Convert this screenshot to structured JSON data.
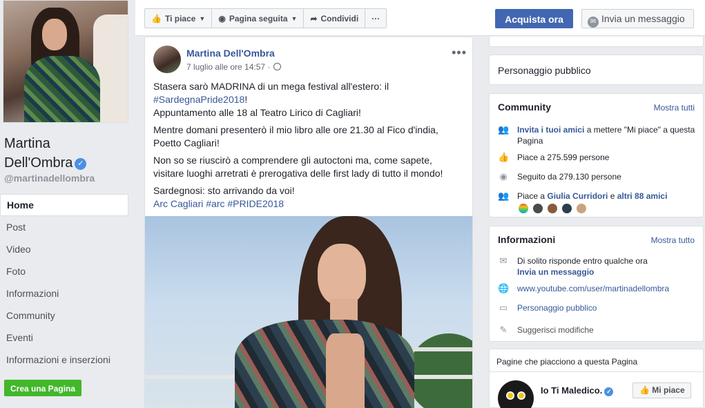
{
  "page": {
    "name_line1": "Martina",
    "name_line2": "Dell'Ombra",
    "handle": "@martinadellombra"
  },
  "nav": {
    "items": [
      "Home",
      "Post",
      "Video",
      "Foto",
      "Informazioni",
      "Community",
      "Eventi",
      "Informazioni e inserzioni"
    ],
    "active": "Home",
    "create_page": "Crea una Pagina"
  },
  "actions": {
    "like": "Ti piace",
    "follow": "Pagina seguita",
    "share": "Condividi",
    "more": "···",
    "buy": "Acquista ora",
    "message": "Invia un messaggio"
  },
  "post": {
    "author": "Martina Dell'Ombra",
    "time": "7 luglio alle ore 14:57 ·",
    "more": "•••",
    "p1_a": "Stasera sarò MADRINA di un mega festival all'estero: il",
    "p1_tag": "#SardegnaPride2018",
    "p1_b": "!",
    "p1_c": "Appuntamento alle 18 al Teatro Lirico di Cagliari!",
    "p2": "Mentre domani presenterò il mio libro alle ore 21.30 al Fico d'india, Poetto Cagliari!",
    "p3": "Non so se riuscirò a comprendere gli autoctoni ma, come sapete, visitare luoghi arretrati è prerogativa delle first lady di tutto il mondo!",
    "p4": "Sardegnosi: sto arrivando da voi!",
    "p4_tags": "Arc Cagliari #arc #PRIDE2018"
  },
  "sidebar": {
    "category": "Personaggio pubblico",
    "community": {
      "title": "Community",
      "see_all": "Mostra tutti",
      "invite_link": "Invita i tuoi amici",
      "invite_rest": " a mettere \"Mi piace\" a questa Pagina",
      "likes": "Piace a 275.599 persone",
      "followers": "Seguito da 279.130 persone",
      "friends_prefix": "Piace a ",
      "friend_name": "Giulia Curridori",
      "friends_mid": " e ",
      "friends_more": "altri 88 amici"
    },
    "info": {
      "title": "Informazioni",
      "see_all": "Mostra tutto",
      "response": "Di solito risponde entro qualche ora",
      "send_message": "Invia un messaggio",
      "website": "www.youtube.com/user/martinadellombra",
      "category": "Personaggio pubblico",
      "suggest": "Suggerisci modifiche"
    },
    "liked_pages": {
      "title": "Pagine che piacciono a questa Pagina",
      "page_name": "Io Ti Maledico.",
      "like_button": "Mi piace"
    }
  },
  "colors": {
    "link": "#365899",
    "primary": "#4267b2",
    "green": "#42b72a"
  }
}
